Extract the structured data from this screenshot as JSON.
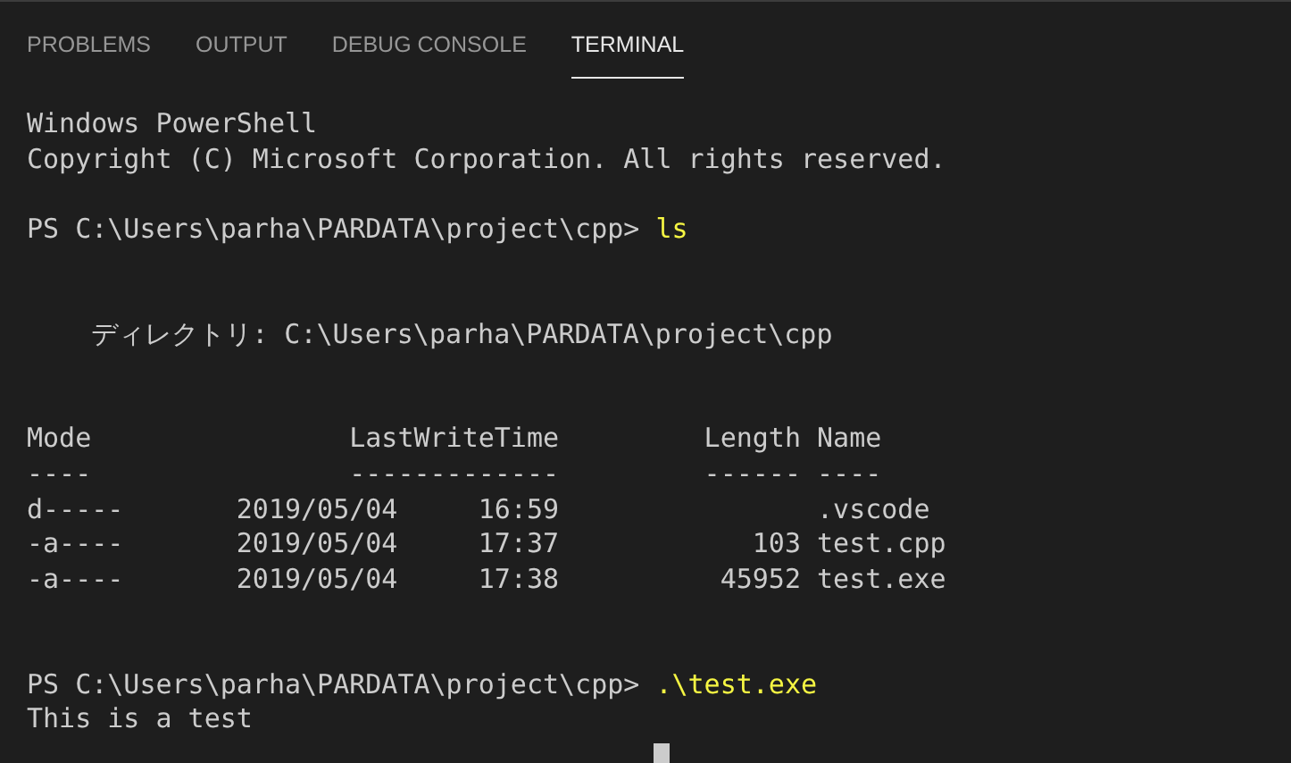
{
  "tabs": [
    {
      "label": "PROBLEMS",
      "selected": false
    },
    {
      "label": "OUTPUT",
      "selected": false
    },
    {
      "label": "DEBUG CONSOLE",
      "selected": false
    },
    {
      "label": "TERMINAL",
      "selected": true
    }
  ],
  "terminal": {
    "lines": [
      {
        "kind": "output",
        "text": "Windows PowerShell"
      },
      {
        "kind": "output",
        "text": "Copyright (C) Microsoft Corporation. All rights reserved."
      },
      {
        "kind": "blank"
      },
      {
        "kind": "prompt",
        "prompt": "PS C:\\Users\\parha\\PARDATA\\project\\cpp> ",
        "command": "ls"
      },
      {
        "kind": "blank"
      },
      {
        "kind": "blank"
      },
      {
        "kind": "output",
        "text": "    ディレクトリ: C:\\Users\\parha\\PARDATA\\project\\cpp"
      },
      {
        "kind": "blank"
      },
      {
        "kind": "blank"
      },
      {
        "kind": "output",
        "text": "Mode                LastWriteTime         Length Name"
      },
      {
        "kind": "output",
        "text": "----                -------------         ------ ----"
      },
      {
        "kind": "output",
        "text": "d-----       2019/05/04     16:59                .vscode"
      },
      {
        "kind": "output",
        "text": "-a----       2019/05/04     17:37            103 test.cpp"
      },
      {
        "kind": "output",
        "text": "-a----       2019/05/04     17:38          45952 test.exe"
      },
      {
        "kind": "blank"
      },
      {
        "kind": "blank"
      },
      {
        "kind": "prompt",
        "prompt": "PS C:\\Users\\parha\\PARDATA\\project\\cpp> ",
        "command": ".\\test.exe"
      },
      {
        "kind": "output",
        "text": "This is a test"
      },
      {
        "kind": "cursor"
      }
    ]
  }
}
